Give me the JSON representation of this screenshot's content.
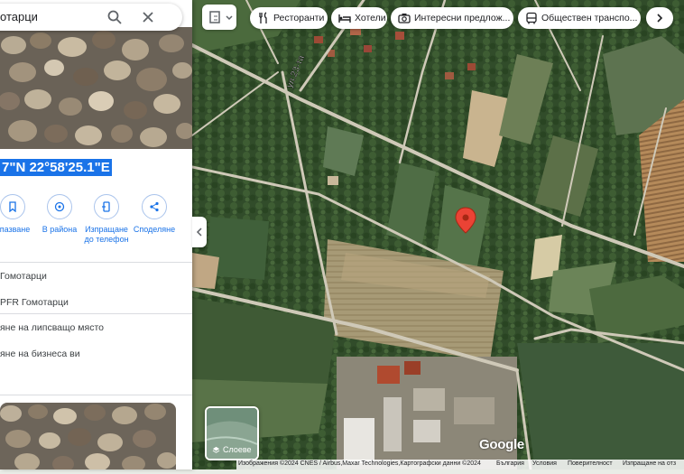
{
  "search": {
    "query": "отарци"
  },
  "place": {
    "coords": "7\"N 22°58'25.1\"E",
    "actions": [
      {
        "label": "апазване"
      },
      {
        "label": "В района"
      },
      {
        "label": "Изпращане до телефон"
      },
      {
        "label": "Споделяне"
      }
    ],
    "info": [
      {
        "text": "Гомотарци"
      },
      {
        "text": "PFR Гомотарци"
      },
      {
        "text": "яне на липсващо място"
      },
      {
        "text": "яне на бизнеса ви"
      }
    ]
  },
  "map": {
    "street_label": "ул.23-та",
    "layer_switch_label": "Слоеве",
    "logo": "Google",
    "chips": [
      {
        "label": "Ресторанти",
        "icon": "fork-knife-icon"
      },
      {
        "label": "Хотели",
        "icon": "bed-icon"
      },
      {
        "label": "Интересни предлож...",
        "icon": "camera-icon"
      },
      {
        "label": "Обществен транспо...",
        "icon": "bus-icon"
      }
    ],
    "footer": {
      "imagery": "Изображения ©2024 CNES / Airbus,Maxar Technologies,Картографски данни ©2024",
      "country": "България",
      "terms": "Условия",
      "privacy": "Поверителност",
      "feedback": "Изпращане на отз"
    }
  },
  "colors": {
    "accent": "#1a73e8",
    "pin": "#ea4335"
  }
}
